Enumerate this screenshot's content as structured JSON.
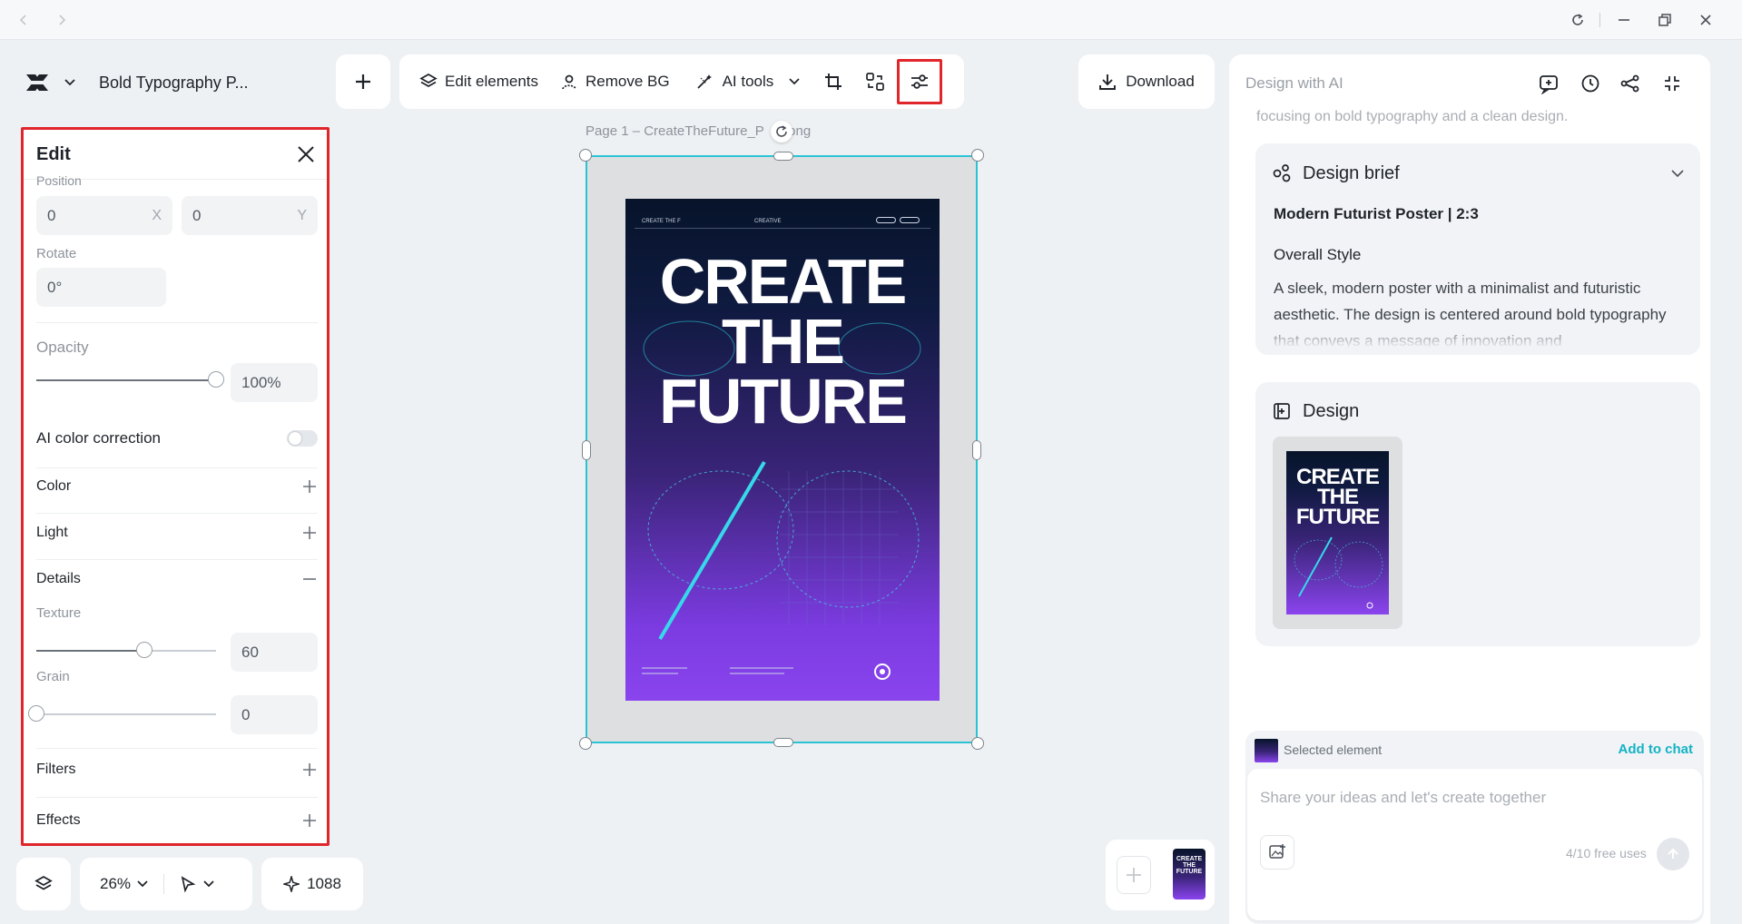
{
  "toolbar": {
    "project_title": "Bold Typography P...",
    "edit_elements": "Edit elements",
    "remove_bg": "Remove BG",
    "ai_tools": "AI tools",
    "download": "Download"
  },
  "edit_panel": {
    "title": "Edit",
    "position_label": "Position",
    "pos_x": "0",
    "pos_x_unit": "X",
    "pos_y": "0",
    "pos_y_unit": "Y",
    "rotate_label": "Rotate",
    "rotate_value": "0°",
    "opacity_label": "Opacity",
    "opacity_value": "100%",
    "opacity_level": 1.0,
    "ai_color_correction": "AI color correction",
    "ai_color_correction_on": false,
    "color": "Color",
    "light": "Light",
    "details": "Details",
    "texture_label": "Texture",
    "texture_value": "60",
    "texture_level": 0.6,
    "grain_label": "Grain",
    "grain_value": "0",
    "grain_level": 0.0,
    "filters": "Filters",
    "effects": "Effects"
  },
  "canvas": {
    "page_label": "Page 1 –  CreateTheFuture_P",
    "page_label_tail": "r.png",
    "poster_title_line1": "CREATE",
    "poster_title_line2": "THE",
    "poster_title_line3": "FUTURE",
    "poster_header_left": "CREATE THE F",
    "poster_header_mid": "CREATIVE",
    "zoom": "26%",
    "credits": "1088"
  },
  "ai_panel": {
    "title": "Design with AI",
    "intro_tail": "focusing on bold typography and a clean design.",
    "brief_title": "Design brief",
    "brief_subtitle": "Modern Futurist Poster | 2:3",
    "overall_style_label": "Overall Style",
    "overall_style_text": "A sleek, modern poster with a minimalist and futuristic aesthetic. The design is centered around bold typography that conveys a message of innovation and",
    "design_title": "Design",
    "selected_element": "Selected element",
    "add_to_chat": "Add to chat",
    "chat_placeholder": "Share your ideas and let's create together",
    "free_uses": "4/10 free uses"
  },
  "colors": {
    "accent_cyan": "#2bc3d4",
    "highlight_red": "#e0262b",
    "link_teal": "#14b3c4"
  }
}
